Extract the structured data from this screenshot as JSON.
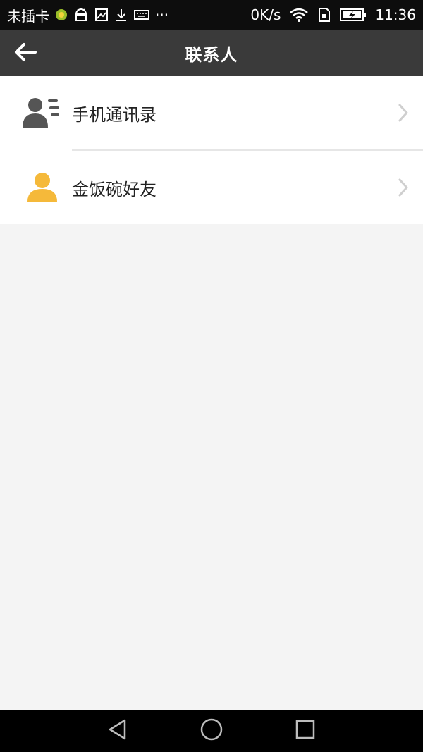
{
  "status_bar": {
    "carrier": "未插卡",
    "more": "···",
    "speed": "0K/s",
    "time": "11:36",
    "icons": [
      "app-badge-icon",
      "android-icon",
      "image-icon",
      "download-icon",
      "keyboard-icon",
      "wifi-icon",
      "sim-lock-icon",
      "battery-charging-icon"
    ]
  },
  "header": {
    "title": "联系人"
  },
  "contacts_menu": {
    "items": [
      {
        "label": "手机通讯录",
        "icon": "contacts-book-icon",
        "icon_color": "#555555"
      },
      {
        "label": "金饭碗好友",
        "icon": "friend-person-icon",
        "icon_color": "#f5b93a"
      }
    ]
  },
  "colors": {
    "status_bar": "#0d0d0d",
    "header": "#3a3a3a",
    "page_background": "#f4f4f4",
    "accent_yellow": "#f5b93a"
  }
}
